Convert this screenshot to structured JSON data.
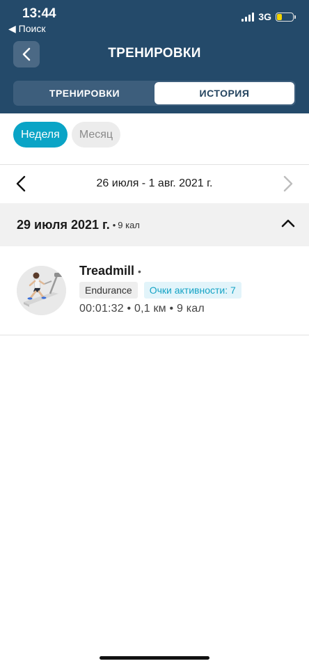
{
  "status_bar": {
    "time": "13:44",
    "back_app": "◀ Поиск",
    "network": "3G",
    "battery_level": 0.3,
    "battery_color": "#f5d500"
  },
  "header": {
    "title": "ТРЕНИРОВКИ",
    "back_icon": "chevron-left-icon",
    "background": "#244a6a"
  },
  "segments": [
    {
      "label": "ТРЕНИРОВКИ",
      "active": false
    },
    {
      "label": "ИСТОРИЯ",
      "active": true
    }
  ],
  "period_filter": {
    "week_label": "Неделя",
    "month_label": "Месяц",
    "selected": "week",
    "accent": "#0aa4c6"
  },
  "date_range": {
    "label": "26 июля - 1 авг. 2021 г.",
    "prev_icon": "chevron-left-icon",
    "next_icon": "chevron-right-icon",
    "next_enabled": false
  },
  "day_group": {
    "date": "29 июля 2021 г.",
    "separator": "•",
    "calories": "9 кал",
    "expanded": true
  },
  "activity": {
    "name": "Treadmill",
    "name_suffix": "•",
    "type_tag": "Endurance",
    "points_tag": "Очки активности: 7",
    "stats": "00:01:32 • 0,1 км • 9 кал",
    "thumbnail_icon": "treadmill-runner-icon"
  }
}
